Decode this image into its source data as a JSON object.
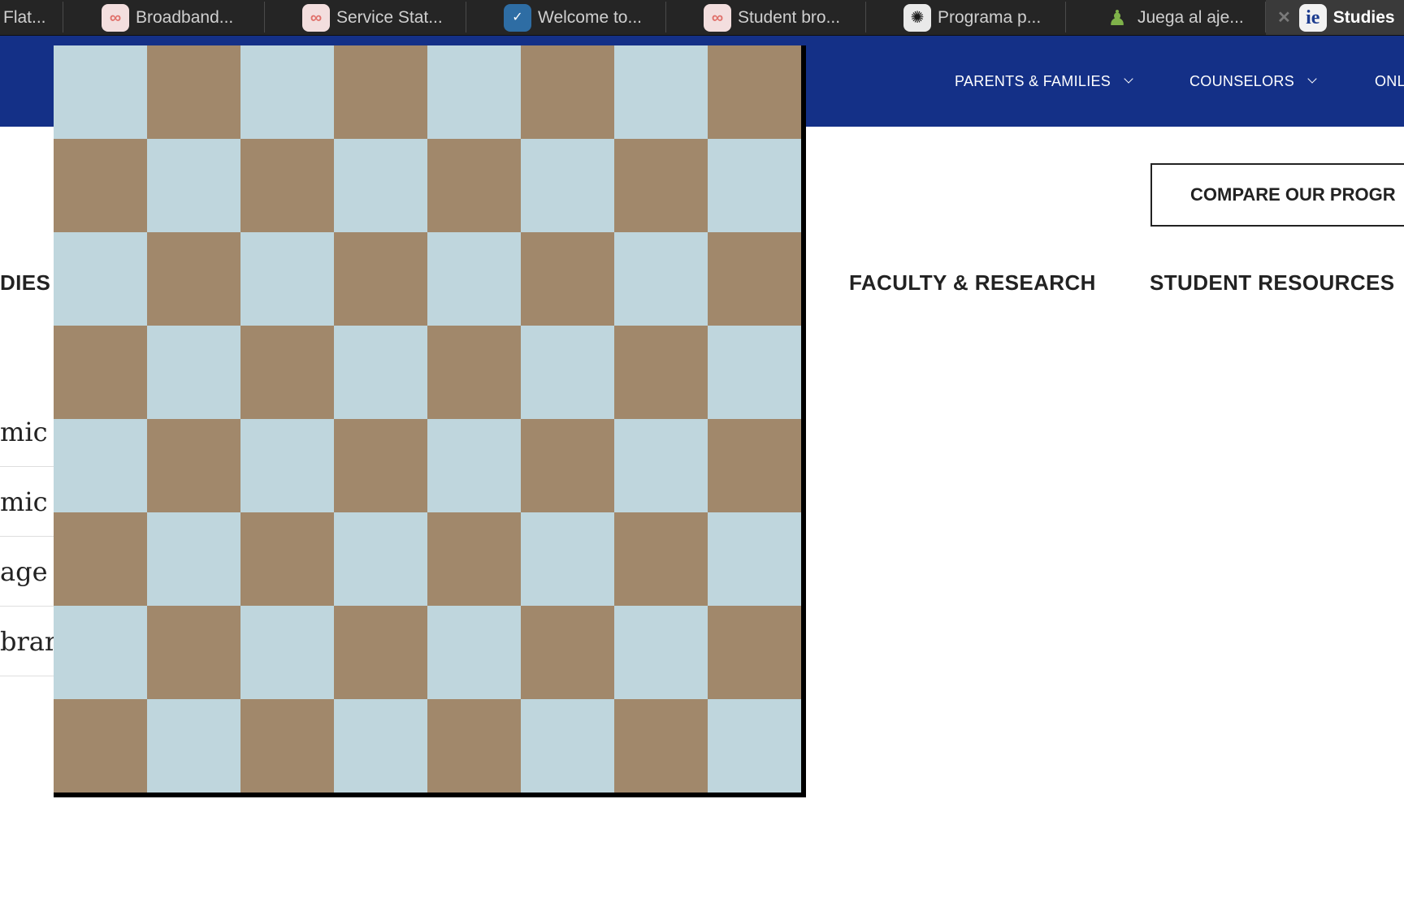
{
  "browser": {
    "tabs": [
      {
        "label": "Flat...",
        "icon": "generic-icon",
        "active": false
      },
      {
        "label": "Broadband...",
        "icon": "infinity-icon",
        "active": false
      },
      {
        "label": "Service Stat...",
        "icon": "infinity-icon",
        "active": false
      },
      {
        "label": "Welcome to...",
        "icon": "welcome-app-icon",
        "active": false
      },
      {
        "label": "Student bro...",
        "icon": "infinity-icon",
        "active": false
      },
      {
        "label": "Programa p...",
        "icon": "openai-icon",
        "active": false
      },
      {
        "label": "Juega al aje...",
        "icon": "chess-pawn-icon",
        "active": false
      },
      {
        "label": "Studies",
        "icon": "ie-logo-icon",
        "active": true
      }
    ]
  },
  "header": {
    "background": "#143087",
    "nav": [
      {
        "label": "PARENTS & FAMILIES"
      },
      {
        "label": "COUNSELORS"
      },
      {
        "label": "ONL"
      }
    ]
  },
  "content": {
    "compare_button": "COMPARE OUR PROGR",
    "main_nav": [
      {
        "label": "DIES"
      },
      {
        "label": "FACULTY & RESEARCH"
      },
      {
        "label": "STUDENT RESOURCES"
      }
    ],
    "side_list": [
      {
        "label": "mic C"
      },
      {
        "label": "mic C"
      },
      {
        "label": "age C"
      },
      {
        "label": "brary"
      }
    ]
  },
  "board": {
    "size": 8,
    "light_color": "#bfd6dd",
    "dark_color": "#a1886b"
  }
}
